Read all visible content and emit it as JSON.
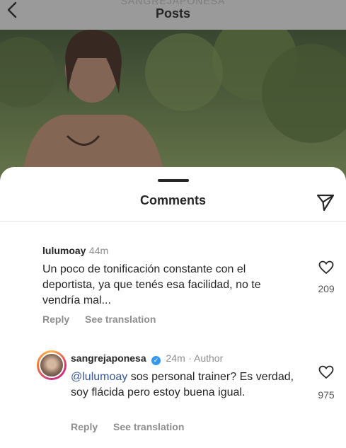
{
  "header": {
    "username": "SANGREJAPONESA",
    "title": "Posts",
    "back_icon": "chevron-left-icon"
  },
  "sheet": {
    "title": "Comments",
    "share_icon": "paper-plane-icon"
  },
  "comments": [
    {
      "username": "lulumoay",
      "time": "44m",
      "text": "Un poco de tonificación constante con el deportista, ya que tenés esa facilidad, no te vendría mal...",
      "likes": "209",
      "reply_label": "Reply",
      "translate_label": "See translation"
    }
  ],
  "reply": {
    "username": "sangrejaponesa",
    "time": "24m",
    "author_tag": "· Author",
    "mention": "@lulumoay",
    "text": " sos personal trainer? Es verdad, soy flácida pero estoy buena igual.",
    "likes": "975",
    "reply_label": "Reply",
    "translate_label": "See translation"
  },
  "colors": {
    "mention": "#385898",
    "verified": "#3897f0",
    "meta": "#8e8e8e"
  }
}
